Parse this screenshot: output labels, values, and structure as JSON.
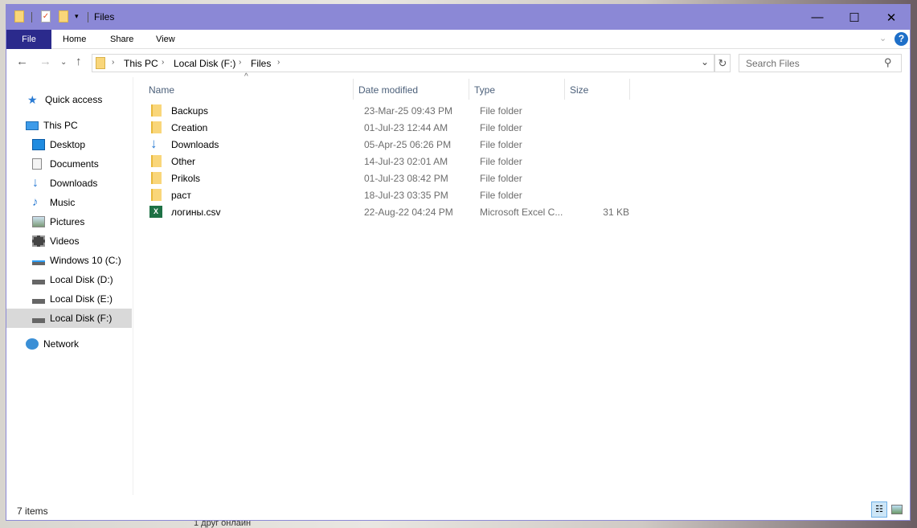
{
  "window": {
    "title": "Files",
    "minimize": "—",
    "maximize": "☐",
    "close": "✕"
  },
  "ribbon": {
    "tabs": [
      "File",
      "Home",
      "Share",
      "View"
    ],
    "help": "?"
  },
  "address": {
    "crumbs": [
      "This PC",
      "Local Disk (F:)",
      "Files"
    ],
    "search_placeholder": "Search Files"
  },
  "nav": {
    "items": [
      {
        "label": "Quick access",
        "icon": "star-icon"
      },
      {
        "label": "This PC",
        "icon": "computer-icon"
      },
      {
        "label": "Desktop",
        "icon": "desktop-icon"
      },
      {
        "label": "Documents",
        "icon": "documents-icon"
      },
      {
        "label": "Downloads",
        "icon": "download-icon"
      },
      {
        "label": "Music",
        "icon": "music-icon"
      },
      {
        "label": "Pictures",
        "icon": "pictures-icon"
      },
      {
        "label": "Videos",
        "icon": "videos-icon"
      },
      {
        "label": "Windows 10 (C:)",
        "icon": "drive-icon"
      },
      {
        "label": "Local Disk (D:)",
        "icon": "drive-icon"
      },
      {
        "label": "Local Disk (E:)",
        "icon": "drive-icon"
      },
      {
        "label": "Local Disk (F:)",
        "icon": "drive-icon"
      },
      {
        "label": "Network",
        "icon": "network-icon"
      }
    ]
  },
  "columns": [
    "Name",
    "Date modified",
    "Type",
    "Size"
  ],
  "files": [
    {
      "name": "Backups",
      "date": "23-Mar-25 09:43 PM",
      "type": "File folder",
      "size": ""
    },
    {
      "name": "Creation",
      "date": "01-Jul-23 12:44 AM",
      "type": "File folder",
      "size": ""
    },
    {
      "name": "Downloads",
      "date": "05-Apr-25 06:26 PM",
      "type": "File folder",
      "size": ""
    },
    {
      "name": "Other",
      "date": "14-Jul-23 02:01 AM",
      "type": "File folder",
      "size": ""
    },
    {
      "name": "Prikols",
      "date": "01-Jul-23 08:42 PM",
      "type": "File folder",
      "size": ""
    },
    {
      "name": "раст",
      "date": "18-Jul-23 03:35 PM",
      "type": "File folder",
      "size": ""
    },
    {
      "name": "логины.csv",
      "date": "22-Aug-22 04:24 PM",
      "type": "Microsoft Excel C...",
      "size": "31 KB"
    }
  ],
  "status": {
    "count": "7 items"
  },
  "background": {
    "text": "1 друг онлайн"
  },
  "colors": {
    "titlebar": "#8b88d6",
    "file_tab": "#2b2a8c",
    "selected": "#d9d9d9"
  }
}
